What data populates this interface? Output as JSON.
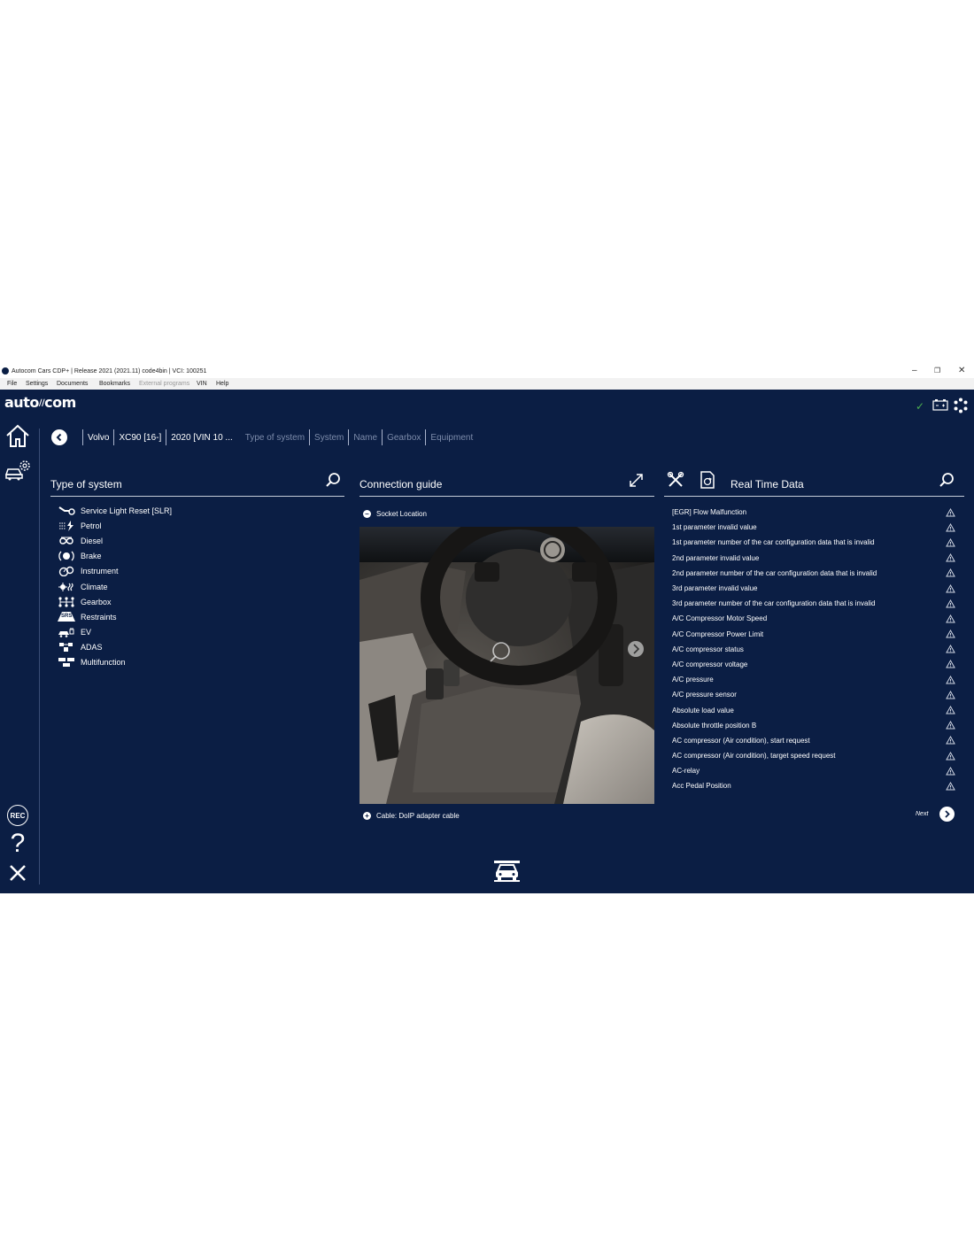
{
  "window": {
    "title": "Autocom Cars CDP+ | Release 2021 (2021.11) code4bin | VCI: 100251",
    "controls": {
      "minimize": "–",
      "restore": "❐",
      "close": "✕"
    }
  },
  "menu": [
    {
      "label": "File",
      "enabled": true
    },
    {
      "label": "Settings",
      "enabled": true
    },
    {
      "label": "Documents",
      "enabled": true
    },
    {
      "label": "Bookmarks",
      "enabled": true
    },
    {
      "label": "External programs",
      "enabled": false
    },
    {
      "label": "VIN",
      "enabled": true
    },
    {
      "label": "Help",
      "enabled": true
    }
  ],
  "brand": {
    "left": "auto",
    "mid": "∕∕",
    "right": "com"
  },
  "status": {
    "check": "✓",
    "check_color": "#4caf50"
  },
  "breadcrumb": [
    {
      "label": "Volvo",
      "active": true
    },
    {
      "label": "XC90 [16-]",
      "active": true
    },
    {
      "label": "2020 [VIN 10 ...",
      "active": true
    },
    {
      "label": "Type of system",
      "active": false
    },
    {
      "label": "System",
      "active": false
    },
    {
      "label": "Name",
      "active": false
    },
    {
      "label": "Gearbox",
      "active": false
    },
    {
      "label": "Equipment",
      "active": false
    }
  ],
  "type_panel": {
    "title": "Type of system",
    "items": [
      {
        "label": "Service Light Reset [SLR]",
        "icon": "wrench-icon"
      },
      {
        "label": "Petrol",
        "icon": "petrol-icon"
      },
      {
        "label": "Diesel",
        "icon": "diesel-icon"
      },
      {
        "label": "Brake",
        "icon": "brake-icon"
      },
      {
        "label": "Instrument",
        "icon": "instrument-icon"
      },
      {
        "label": "Climate",
        "icon": "climate-icon"
      },
      {
        "label": "Gearbox",
        "icon": "gearbox-icon"
      },
      {
        "label": "Restraints",
        "icon": "srs-icon",
        "icon_text": "SRS"
      },
      {
        "label": "EV",
        "icon": "ev-icon"
      },
      {
        "label": "ADAS",
        "icon": "adas-icon"
      },
      {
        "label": "Multifunction",
        "icon": "multifunction-icon"
      }
    ]
  },
  "connection_panel": {
    "title": "Connection guide",
    "socket_label": "Socket Location",
    "cable_label": "Cable: DoIP adapter cable"
  },
  "rtd_panel": {
    "title": "Real Time Data",
    "items": [
      "[EGR] Flow Malfunction",
      "1st parameter invalid value",
      "1st parameter number of the car configuration data that is invalid",
      "2nd parameter invalid value",
      "2nd parameter number of the car configuration data that is invalid",
      "3rd parameter invalid value",
      "3rd parameter number of the car configuration data that is invalid",
      "A/C Compressor Motor Speed",
      "A/C Compressor Power Limit",
      "A/C compressor status",
      "A/C compressor voltage",
      "A/C pressure",
      "A/C pressure sensor",
      "Absolute load value",
      "Absolute throttle position B",
      "AC compressor (Air condition), start request",
      "AC compressor (Air condition), target speed request",
      "AC-relay",
      "Acc Pedal Position"
    ],
    "next_label": "Next"
  },
  "sidebar": {
    "rec_label": "REC",
    "help_label": "?"
  },
  "colors": {
    "background": "#0b1e44",
    "accent": "#ffffff",
    "divider": "#c5cbd8"
  }
}
